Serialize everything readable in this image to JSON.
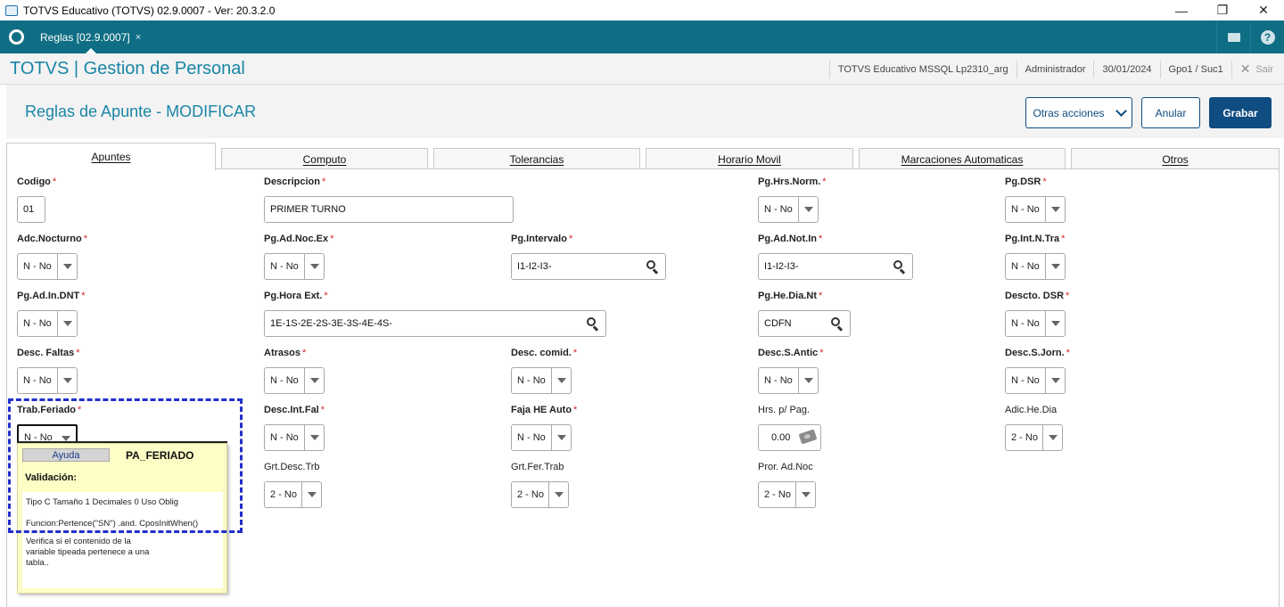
{
  "window": {
    "title": "TOTVS Educativo (TOTVS) 02.9.0007 - Ver: 20.3.2.0",
    "minimize": "—",
    "restore": "❐",
    "close": "✕"
  },
  "app_tab": {
    "label": "Reglas [02.9.0007]",
    "close": "×"
  },
  "module": {
    "title": "TOTVS | Gestion de Personal",
    "environment": "TOTVS Educativo MSSQL Lp2310_arg",
    "user": "Administrador",
    "date": "30/01/2024",
    "branch": "Gpo1 / Suc1",
    "exit_label": "Sair"
  },
  "page": {
    "title": "Reglas de Apunte - MODIFICAR",
    "other_actions": "Otras acciones",
    "cancel": "Anular",
    "save": "Grabar"
  },
  "tabs": [
    "Apuntes",
    "Computo",
    "Tolerancias",
    "Horario Movil",
    "Marcaciones Automaticas",
    "Otros"
  ],
  "fields": {
    "codigo": {
      "label": "Codigo",
      "value": "01"
    },
    "descripcion": {
      "label": "Descripcion",
      "value": "PRIMER TURNO"
    },
    "pg_hrs_norm": {
      "label": "Pg.Hrs.Norm.",
      "value": "N - No"
    },
    "pg_dsr": {
      "label": "Pg.DSR",
      "value": "N - No"
    },
    "adc_nocturno": {
      "label": "Adc.Nocturno",
      "value": "N - No"
    },
    "pg_ad_noc_ex": {
      "label": "Pg.Ad.Noc.Ex",
      "value": "N - No"
    },
    "pg_intervalo": {
      "label": "Pg.Intervalo",
      "value": "I1-I2-I3-"
    },
    "pg_ad_not_in": {
      "label": "Pg.Ad.Not.In",
      "value": "I1-I2-I3-"
    },
    "pg_int_n_tra": {
      "label": "Pg.Int.N.Tra",
      "value": "N - No"
    },
    "pg_ad_in_dnt": {
      "label": "Pg.Ad.In.DNT",
      "value": "N - No"
    },
    "pg_hora_ext": {
      "label": "Pg.Hora Ext.",
      "value": "1E-1S-2E-2S-3E-3S-4E-4S-"
    },
    "pg_he_dia_nt": {
      "label": "Pg.He.Dia.Nt",
      "value": "CDFN"
    },
    "descto_dsr": {
      "label": "Descto. DSR",
      "value": "N - No"
    },
    "desc_faltas": {
      "label": "Desc. Faltas",
      "value": "N - No"
    },
    "atrasos": {
      "label": "Atrasos",
      "value": "N - No"
    },
    "desc_comid": {
      "label": "Desc. comid.",
      "value": "N - No"
    },
    "desc_s_antic": {
      "label": "Desc.S.Antic",
      "value": "N - No"
    },
    "desc_s_jorn": {
      "label": "Desc.S.Jorn.",
      "value": "N - No"
    },
    "trab_feriado": {
      "label": "Trab.Feriado",
      "value": "N - No"
    },
    "desc_int_fal": {
      "label": "Desc.Int.Fal",
      "value": "N - No"
    },
    "faja_he_auto": {
      "label": "Faja HE Auto",
      "value": "N - No"
    },
    "hrs_p_pag": {
      "label": "Hrs. p/ Pag.",
      "value": "0.00"
    },
    "adic_he_dia": {
      "label": "Adic.He.Dia",
      "value": "2 - No"
    },
    "grt_desc_trb": {
      "label": "Grt.Desc.Trb",
      "value": "2 - No"
    },
    "grt_fer_trab": {
      "label": "Grt.Fer.Trab",
      "value": "2 - No"
    },
    "pror_ad_noc": {
      "label": "Pror. Ad.Noc",
      "value": "2 - No"
    }
  },
  "required_mark": "*",
  "help_popup": {
    "button": "Ayuda",
    "field_name": "PA_FERIADO",
    "validation_title": "Validación:",
    "type_line": "Tipo C Tamaño   1 Decimales 0  Uso Oblig",
    "function_line": "Funcion:Pertence(\"SN\") .and. CposInitWhen()",
    "description_1": "Verifica si el contenido de la",
    "description_2": "variable tipeada pertenece a una",
    "description_3": "tabla.."
  },
  "icons": {
    "search": "search-icon",
    "money": "money-icon",
    "dropdown": "chevron-down-icon",
    "mail": "mail-icon",
    "help": "help-icon"
  },
  "colors": {
    "brand": "#0f6e84",
    "title_blue": "#1a86a6",
    "primary_button": "#0f4c81",
    "required": "#d8232a",
    "focus_outline": "#1e2fcc"
  }
}
